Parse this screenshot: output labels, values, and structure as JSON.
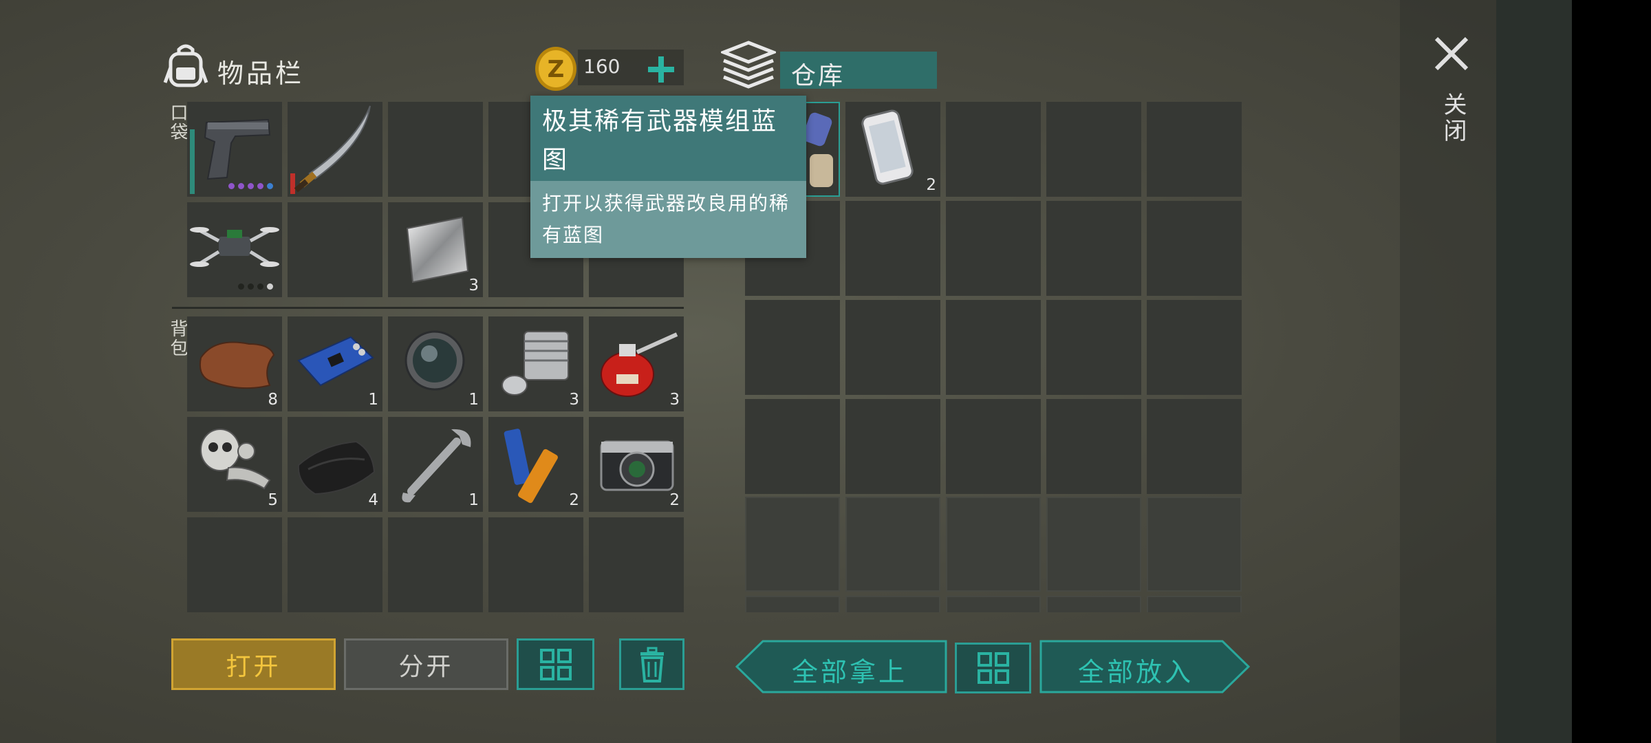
{
  "inventory": {
    "title": "物品栏"
  },
  "currency": {
    "amount": "160"
  },
  "storage": {
    "title": "仓库"
  },
  "close_label": "关闭",
  "sections": {
    "pocket": "口袋",
    "backpack": "背包"
  },
  "pocket_items": [
    {
      "name": "pistol-icon",
      "count": "",
      "durability_color": "#2e8a7a"
    },
    {
      "name": "katana-icon",
      "count": "",
      "durability_color": "#c0302a"
    },
    {
      "name": "drone-icon",
      "count": ""
    },
    {
      "name": "metal-sheet-icon",
      "count": "3"
    }
  ],
  "backpack_items": [
    {
      "name": "leather-icon",
      "count": "8"
    },
    {
      "name": "circuit-board-icon",
      "count": "1"
    },
    {
      "name": "lens-icon",
      "count": "1"
    },
    {
      "name": "engine-cylinder-icon",
      "count": "3"
    },
    {
      "name": "oil-can-icon",
      "count": "3"
    },
    {
      "name": "gas-mask-parts-icon",
      "count": "5"
    },
    {
      "name": "fabric-icon",
      "count": "4"
    },
    {
      "name": "wrench-icon",
      "count": "1"
    },
    {
      "name": "batteries-icon",
      "count": "2"
    },
    {
      "name": "camera-icon",
      "count": "2"
    }
  ],
  "storage_items": [
    {
      "name": "blueprint-scroll-icon",
      "count": ""
    },
    {
      "name": "smartphone-icon",
      "count": "2"
    }
  ],
  "tooltip": {
    "title": "极其稀有武器模组蓝图",
    "description": "打开以获得武器改良用的稀有蓝图"
  },
  "buttons": {
    "open": "打开",
    "split": "分开",
    "take_all": "全部拿上",
    "put_all": "全部放入"
  },
  "colors": {
    "accent": "#2a9e94",
    "open_button": "#b8922a",
    "tooltip_bg": "#3f7878"
  }
}
